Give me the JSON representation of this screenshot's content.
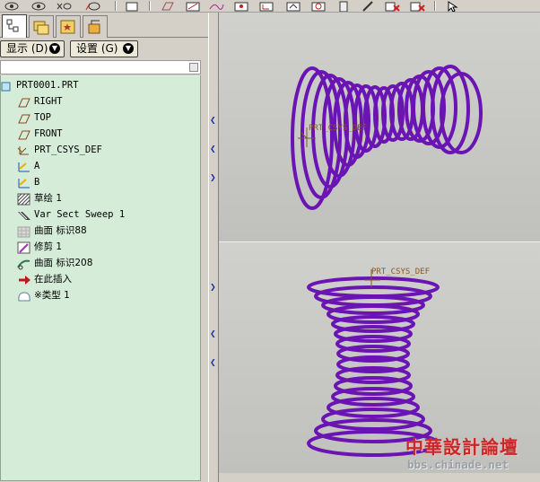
{
  "left_panel": {
    "display_menu": "显示 (D)",
    "settings_menu": "设置 (G)",
    "tree": [
      {
        "label": "PRT0001.PRT",
        "icon": "part-icon",
        "mono": true
      },
      {
        "label": "RIGHT",
        "icon": "datum-plane-icon",
        "mono": true
      },
      {
        "label": "TOP",
        "icon": "datum-plane-icon",
        "mono": true
      },
      {
        "label": "FRONT",
        "icon": "datum-plane-icon",
        "mono": true
      },
      {
        "label": "PRT_CSYS_DEF",
        "icon": "coordinate-system-icon",
        "mono": true
      },
      {
        "label": "A",
        "icon": "datum-curve-icon",
        "mono": true
      },
      {
        "label": "B",
        "icon": "datum-curve-icon",
        "mono": true
      },
      {
        "label": "草绘 1",
        "icon": "sketch-icon",
        "mono": false
      },
      {
        "label": "Var Sect Sweep 1",
        "icon": "sweep-icon",
        "mono": true
      },
      {
        "label": "曲面 标识88",
        "icon": "surface-icon",
        "mono": false
      },
      {
        "label": "修剪 1",
        "icon": "trim-icon",
        "mono": false
      },
      {
        "label": "曲面 标识208",
        "icon": "surface-curve-icon",
        "mono": false
      },
      {
        "label": "在此插入",
        "icon": "insert-here-arrow-icon",
        "mono": false
      },
      {
        "label": "※类型 1",
        "icon": "type-icon",
        "mono": false
      }
    ]
  },
  "viewports": {
    "top_csys_label": "PRT_CSYS_DEF",
    "bottom_csys_label": "PRT_CSYS_DEF",
    "spring_color": "#6a14b4"
  },
  "watermark": {
    "title": "中華設計論壇",
    "url": "bbs.chinade.net"
  },
  "colors": {
    "tree_background": "#d5ecd8",
    "viewport_background": "#c8c8c5"
  }
}
